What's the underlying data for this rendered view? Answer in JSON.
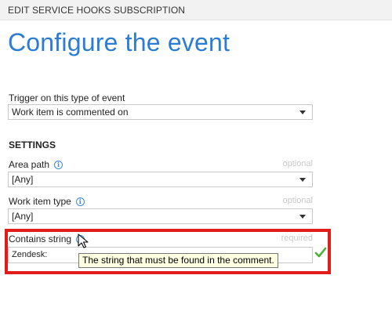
{
  "window": {
    "title": "EDIT SERVICE HOOKS SUBSCRIPTION"
  },
  "page": {
    "title": "Configure the event"
  },
  "trigger": {
    "label": "Trigger on this type of event",
    "value": "Work item is commented on"
  },
  "settings": {
    "heading": "SETTINGS",
    "area_path": {
      "label": "Area path",
      "hint": "optional",
      "value": "[Any]"
    },
    "work_item_type": {
      "label": "Work item type",
      "hint": "optional",
      "value": "[Any]"
    },
    "contains_string": {
      "label": "Contains string",
      "hint": "required",
      "value": "Zendesk:",
      "tooltip": "The string that must be found in the comment."
    }
  },
  "icons": {
    "info": "info-icon",
    "check": "check-icon",
    "cursor": "mouse-pointer-icon",
    "dropdown": "chevron-down-icon"
  },
  "colors": {
    "title_blue": "#2b7cd3",
    "highlight_red": "#e21b1b",
    "check_green": "#4caf30",
    "tooltip_bg": "#ffffe1"
  }
}
